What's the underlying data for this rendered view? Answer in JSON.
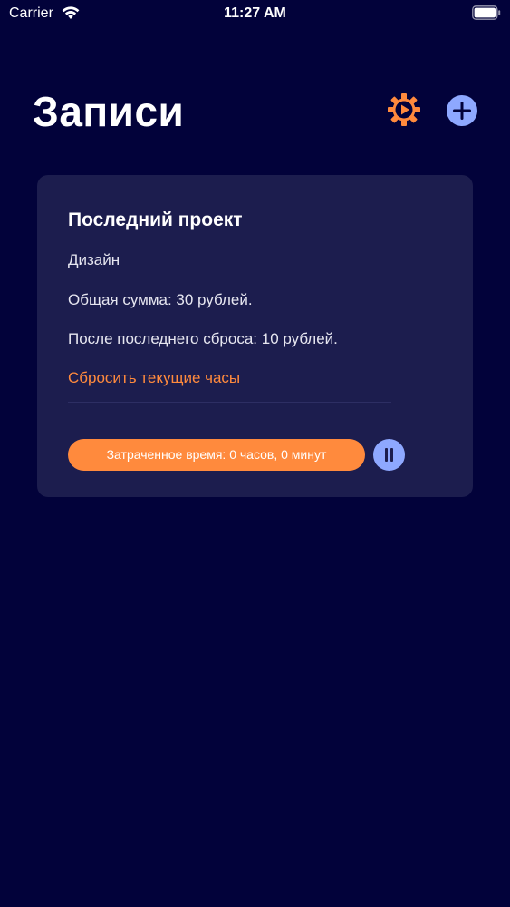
{
  "status_bar": {
    "carrier": "Carrier",
    "time": "11:27 AM"
  },
  "header": {
    "title": "Записи",
    "settings_icon": "gear-icon",
    "add_icon": "plus-icon"
  },
  "card": {
    "title": "Последний проект",
    "category": "Дизайн",
    "total": "Общая сумма: 30 рублей.",
    "since_reset": "После последнего сброса: 10 рублей.",
    "reset_label": "Сбросить текущие часы",
    "time_spent": "Затраченное время: 0 часов, 0 минут",
    "pause_icon": "pause-icon"
  },
  "colors": {
    "background": "#02023a",
    "card": "#1c1d4e",
    "accent": "#ff8a3d",
    "button_blue": "#8ea8ff"
  }
}
